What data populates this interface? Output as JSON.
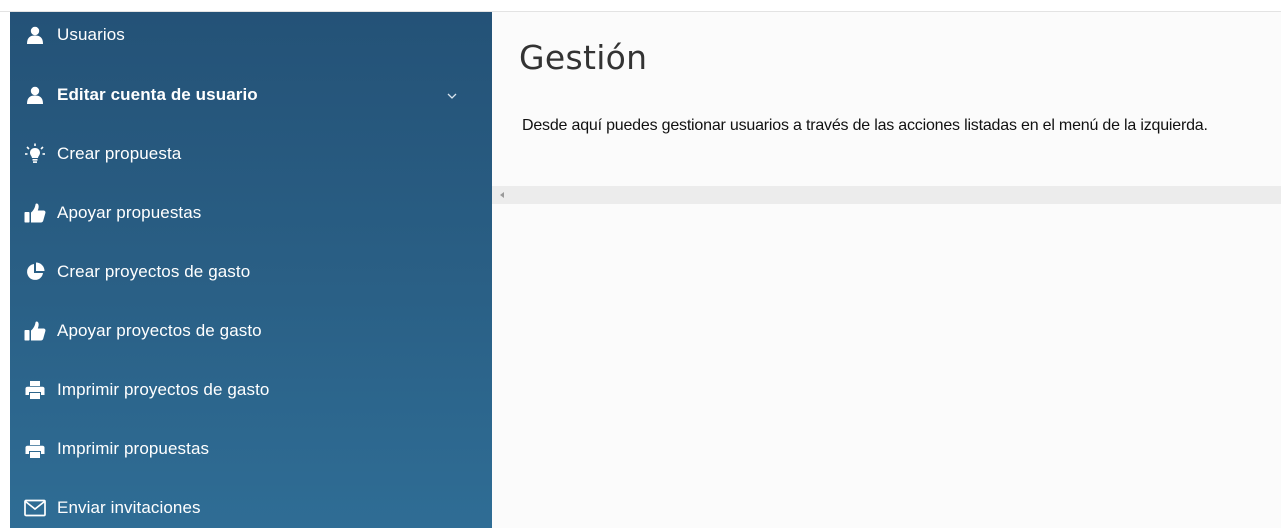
{
  "sidebar": {
    "items": [
      {
        "label": "Usuarios",
        "icon": "user-icon"
      },
      {
        "label": "Editar cuenta de usuario",
        "icon": "user-icon",
        "expanded": true
      },
      {
        "label": "Crear propuesta",
        "icon": "lightbulb-icon"
      },
      {
        "label": "Apoyar propuestas",
        "icon": "thumbs-up-icon"
      },
      {
        "label": "Crear proyectos de gasto",
        "icon": "pie-chart-icon"
      },
      {
        "label": "Apoyar proyectos de gasto",
        "icon": "thumbs-up-icon"
      },
      {
        "label": "Imprimir proyectos de gasto",
        "icon": "printer-icon"
      },
      {
        "label": "Imprimir propuestas",
        "icon": "printer-icon"
      },
      {
        "label": "Enviar invitaciones",
        "icon": "envelope-icon"
      }
    ]
  },
  "main": {
    "title": "Gestión",
    "description": "Desde aquí puedes gestionar usuarios a través de las acciones listadas en el menú de la izquierda."
  },
  "colors": {
    "sidebar_top": "#245277",
    "sidebar_bottom": "#2f6d95",
    "main_background": "#fbfbfb",
    "text": "#111111"
  }
}
